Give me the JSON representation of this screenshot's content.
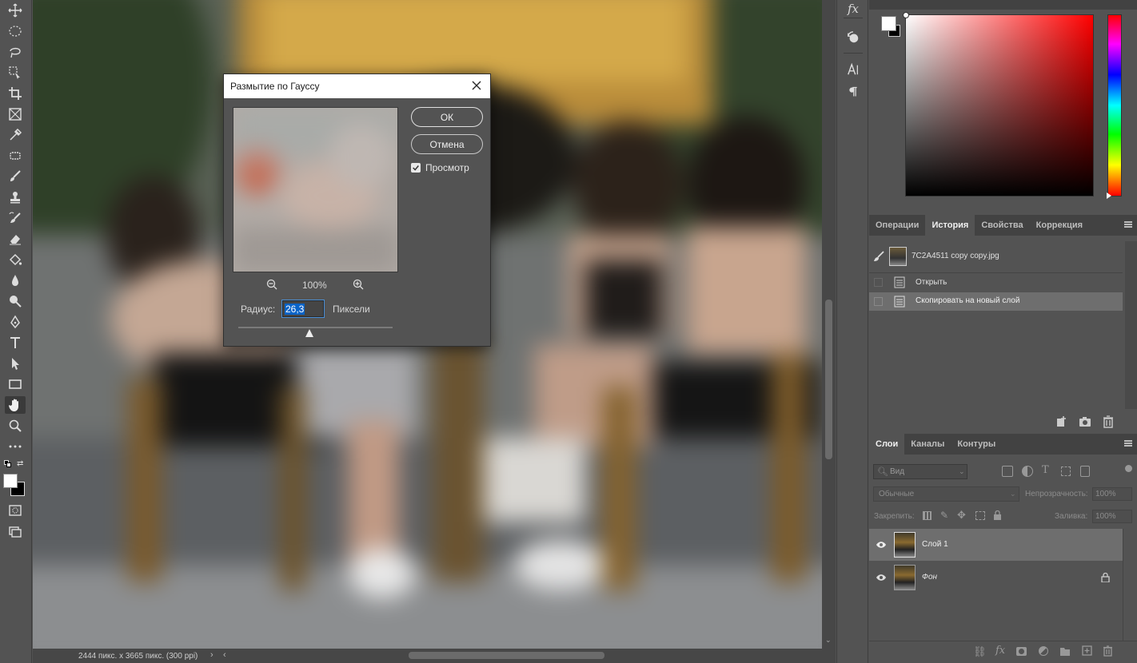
{
  "dialog": {
    "title": "Размытие по Гауссу",
    "ok_label": "ОК",
    "cancel_label": "Отмена",
    "preview_label": "Просмотр",
    "preview_checked": true,
    "zoom": "100%",
    "radius_label": "Радиус:",
    "radius_value": "26,3",
    "units_label": "Пиксели",
    "slider_fraction": 0.46
  },
  "status": {
    "doc_info": "2444 пикс. x 3665 пикс. (300 ppi)"
  },
  "midstrip": {
    "fx_label": "fx"
  },
  "history_panel": {
    "tabs": [
      "Операции",
      "История",
      "Свойства",
      "Коррекция"
    ],
    "active_tab": "История",
    "snapshot_name": "7C2A4511 copy copy.jpg",
    "items": [
      "Открыть",
      "Скопировать на новый слой"
    ]
  },
  "layers_panel": {
    "tabs": [
      "Слои",
      "Каналы",
      "Контуры"
    ],
    "active_tab": "Слои",
    "filter_placeholder": "Вид",
    "blend_mode": "Обычные",
    "opacity_label": "Непрозрачность:",
    "opacity_value": "100%",
    "lock_label": "Закрепить:",
    "fill_label": "Заливка:",
    "fill_value": "100%",
    "layers": [
      {
        "name": "Слой 1",
        "selected": true,
        "locked": false
      },
      {
        "name": "Фон",
        "selected": false,
        "locked": true
      }
    ]
  },
  "colors": {
    "foreground": "#ffffff",
    "background": "#000000",
    "accent_selection": "#0a64c8"
  }
}
